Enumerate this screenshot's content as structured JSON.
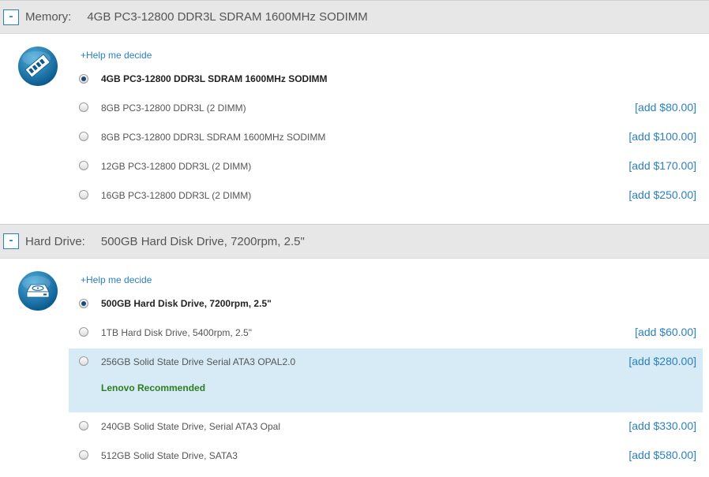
{
  "memory": {
    "toggle": "-",
    "label": "Memory:",
    "selected_value": "4GB PC3-12800 DDR3L SDRAM 1600MHz SODIMM",
    "icon": "memory-module-icon",
    "help_link": "+Help me decide",
    "options": [
      {
        "label": "4GB PC3-12800 DDR3L SDRAM 1600MHz SODIMM",
        "price": "",
        "selected": true
      },
      {
        "label": "8GB PC3-12800 DDR3L (2 DIMM)",
        "price": "[add $80.00]",
        "selected": false
      },
      {
        "label": "8GB PC3-12800 DDR3L SDRAM 1600MHz SODIMM",
        "price": "[add $100.00]",
        "selected": false
      },
      {
        "label": "12GB PC3-12800 DDR3L (2 DIMM)",
        "price": "[add $170.00]",
        "selected": false
      },
      {
        "label": "16GB PC3-12800 DDR3L (2 DIMM)",
        "price": "[add $250.00]",
        "selected": false
      }
    ]
  },
  "hard_drive": {
    "toggle": "-",
    "label": "Hard Drive:",
    "selected_value": "500GB Hard Disk Drive, 7200rpm, 2.5\"",
    "icon": "hard-drive-icon",
    "help_link": "+Help me decide",
    "options": [
      {
        "label": "500GB Hard Disk Drive, 7200rpm, 2.5\"",
        "price": "",
        "selected": true
      },
      {
        "label": "1TB Hard Disk Drive, 5400rpm, 2.5\"",
        "price": "[add $60.00]",
        "selected": false
      },
      {
        "label": "256GB Solid State Drive Serial ATA3 OPAL2.0",
        "price": "[add $280.00]",
        "selected": false,
        "badge": "Lenovo Recommended"
      },
      {
        "label": "240GB Solid State Drive, Serial ATA3 Opal",
        "price": "[add $330.00]",
        "selected": false
      },
      {
        "label": "512GB Solid State Drive, SATA3",
        "price": "[add $580.00]",
        "selected": false
      }
    ]
  },
  "colors": {
    "accent": "#2b7fc0",
    "header_bg": "#e7e7e7",
    "highlight_bg": "#d6ebf6",
    "recommended": "#2e7d1f"
  }
}
